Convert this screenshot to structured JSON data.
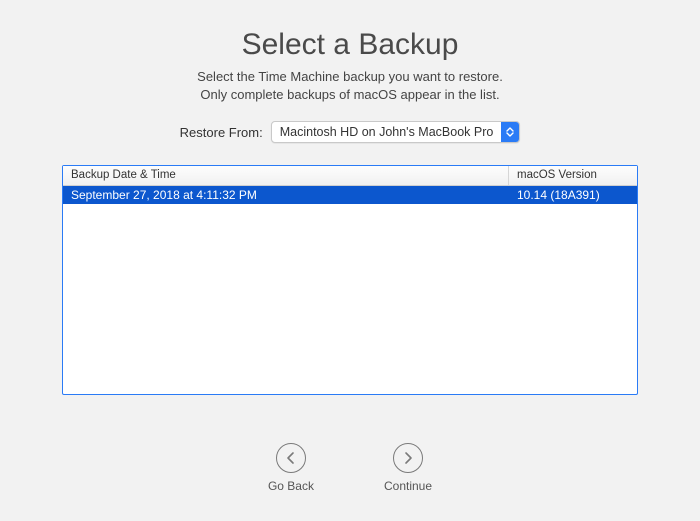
{
  "title": "Select a Backup",
  "subtitle_line1": "Select the Time Machine backup you want to restore.",
  "subtitle_line2": "Only complete backups of macOS appear in the list.",
  "restore_label": "Restore From:",
  "restore_select": "Macintosh HD on John's MacBook Pro",
  "columns": {
    "date": "Backup Date & Time",
    "version": "macOS Version"
  },
  "rows": [
    {
      "date": "September 27, 2018 at 4:11:32 PM",
      "version": "10.14 (18A391)"
    }
  ],
  "buttons": {
    "back": "Go Back",
    "continue": "Continue"
  }
}
